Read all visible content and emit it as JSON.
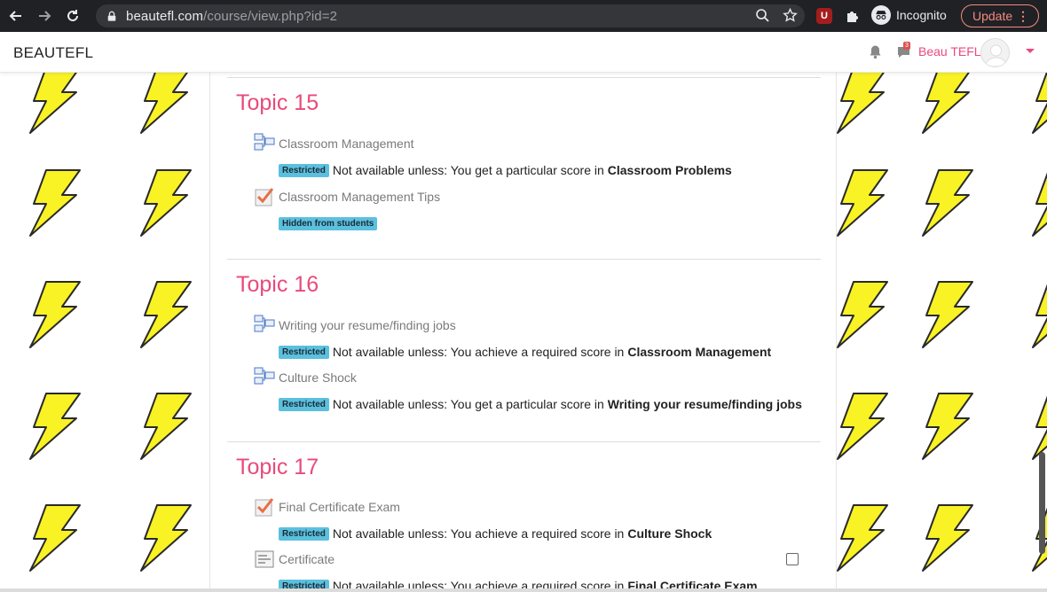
{
  "browser": {
    "url_host": "beautefl.com",
    "url_path": "/course/view.php?id=2",
    "ext_badge": "U",
    "incognito_label": "Incognito",
    "update_label": "Update",
    "update_menu": "⋮"
  },
  "header": {
    "brand": "BEAUTEFL",
    "messages_count": "3",
    "user_name": "Beau TEFL"
  },
  "colors": {
    "accent": "#e94a7c",
    "badge": "#5bc0de",
    "bolt_fill": "#f9f224"
  },
  "topics": [
    {
      "title": "Topic 15",
      "activities": [
        {
          "name": "Classroom Management",
          "icon": "lesson-icon",
          "badge": "Restricted",
          "text": "Not available unless: You get a particular score in",
          "bold": "Classroom Problems"
        },
        {
          "name": "Classroom Management Tips",
          "icon": "quiz-icon",
          "badge": "Hidden from students",
          "text": "",
          "bold": ""
        }
      ]
    },
    {
      "title": "Topic 16",
      "activities": [
        {
          "name": "Writing your resume/finding jobs",
          "icon": "lesson-icon",
          "badge": "Restricted",
          "text": "Not available unless: You achieve a required score in",
          "bold": "Classroom Management"
        },
        {
          "name": "Culture Shock",
          "icon": "lesson-icon",
          "badge": "Restricted",
          "text": "Not available unless: You get a particular score in",
          "bold": "Writing your resume/finding jobs"
        }
      ]
    },
    {
      "title": "Topic 17",
      "activities": [
        {
          "name": "Final Certificate Exam",
          "icon": "quiz-icon",
          "badge": "Restricted",
          "text": "Not available unless: You achieve a required score in",
          "bold": "Culture Shock"
        },
        {
          "name": "Certificate",
          "icon": "certificate-icon",
          "badge": "Restricted",
          "text": "Not available unless: You achieve a required score in",
          "bold": "Final Certificate Exam"
        }
      ]
    }
  ]
}
